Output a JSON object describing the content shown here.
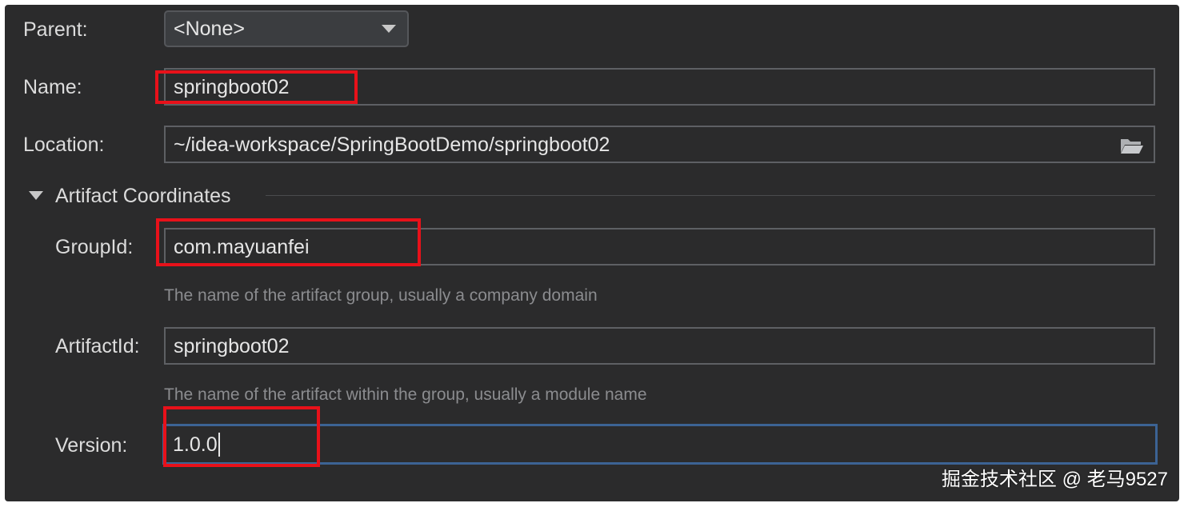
{
  "form": {
    "parent": {
      "label": "Parent:",
      "value": "<None>"
    },
    "name": {
      "label": "Name:",
      "value": "springboot02"
    },
    "location": {
      "label": "Location:",
      "value": "~/idea-workspace/SpringBootDemo/springboot02"
    },
    "artifact_section": {
      "title": "Artifact Coordinates",
      "group_id": {
        "label": "GroupId:",
        "value": "com.mayuanfei",
        "hint": "The name of the artifact group, usually a company domain"
      },
      "artifact_id": {
        "label": "ArtifactId:",
        "value": "springboot02",
        "hint": "The name of the artifact within the group, usually a module name"
      },
      "version": {
        "label": "Version:",
        "value": "1.0.0"
      }
    }
  },
  "icons": {
    "dropdown": "chevron-down-icon",
    "browse": "folder-icon",
    "section": "triangle-down-icon"
  },
  "colors": {
    "highlight_box": "#e8111a",
    "focus_border": "#3c6394",
    "panel_bg": "#2b2b2c"
  },
  "watermark": "掘金技术社区 @ 老马9527"
}
